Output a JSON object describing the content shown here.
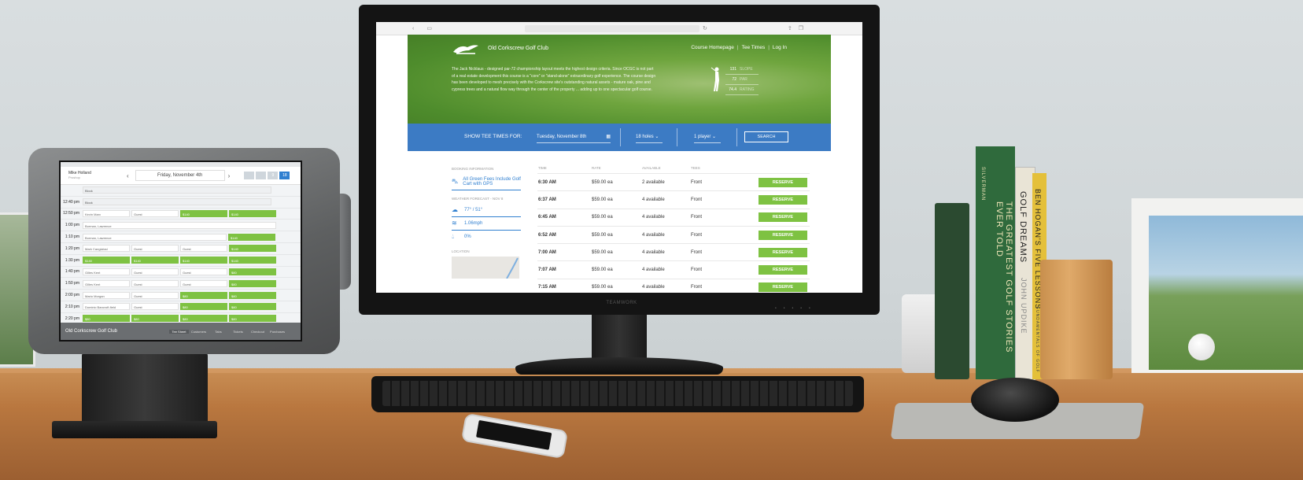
{
  "colors": {
    "hero_green": "#5a9636",
    "search_bar_blue": "#3c7bc4",
    "reserve_green": "#7ec242",
    "link_blue": "#2f7fd0"
  },
  "tablet": {
    "user_name": "Mike Holland",
    "user_role": "Proshop",
    "date": "Friday, November 4th",
    "seg": [
      "",
      "",
      "9",
      "18"
    ],
    "rows": [
      {
        "time": "",
        "slots": [
          {
            "t": "Block",
            "k": "n",
            "w": 240
          }
        ]
      },
      {
        "time": "12:40 pm",
        "slots": [
          {
            "t": "Block",
            "k": "n",
            "w": 240
          }
        ]
      },
      {
        "time": "12:50 pm",
        "slots": [
          {
            "t": "Kevin Marx",
            "k": "w",
            "w": 60
          },
          {
            "t": "Guest",
            "k": "w",
            "w": 60
          },
          {
            "t": "$140",
            "k": "g",
            "w": 60
          },
          {
            "t": "$140",
            "k": "g",
            "w": 60
          }
        ]
      },
      {
        "time": "1:00 pm",
        "slots": [
          {
            "t": "Borman, Lawrence",
            "k": "w",
            "w": 246
          }
        ]
      },
      {
        "time": "1:10 pm",
        "slots": [
          {
            "t": "Borman, Lawrence",
            "k": "w",
            "w": 183
          },
          {
            "t": "$140",
            "k": "g",
            "w": 60
          }
        ]
      },
      {
        "time": "1:20 pm",
        "slots": [
          {
            "t": "Mark Cangialosi",
            "k": "w",
            "w": 60
          },
          {
            "t": "Guest",
            "k": "w",
            "w": 60
          },
          {
            "t": "Guest",
            "k": "w",
            "w": 60
          },
          {
            "t": "$140",
            "k": "g",
            "w": 60
          }
        ]
      },
      {
        "time": "1:30 pm",
        "slots": [
          {
            "t": "$140",
            "k": "g",
            "w": 60
          },
          {
            "t": "$140",
            "k": "g",
            "w": 60
          },
          {
            "t": "$140",
            "k": "g",
            "w": 60
          },
          {
            "t": "$140",
            "k": "g",
            "w": 60
          }
        ]
      },
      {
        "time": "1:40 pm",
        "slots": [
          {
            "t": "Gilles Kent",
            "k": "w",
            "w": 60
          },
          {
            "t": "Guest",
            "k": "w",
            "w": 60
          },
          {
            "t": "Guest",
            "k": "w",
            "w": 60
          },
          {
            "t": "$80",
            "k": "g",
            "w": 60
          }
        ]
      },
      {
        "time": "1:50 pm",
        "slots": [
          {
            "t": "Gilles Kent",
            "k": "w",
            "w": 60
          },
          {
            "t": "Guest",
            "k": "w",
            "w": 60
          },
          {
            "t": "Guest",
            "k": "w",
            "w": 60
          },
          {
            "t": "$80",
            "k": "g",
            "w": 60
          }
        ]
      },
      {
        "time": "2:00 pm",
        "slots": [
          {
            "t": "Mario Morgan",
            "k": "w",
            "w": 60
          },
          {
            "t": "Guest",
            "k": "w",
            "w": 60
          },
          {
            "t": "$80",
            "k": "g",
            "w": 60
          },
          {
            "t": "$80",
            "k": "g",
            "w": 60
          }
        ]
      },
      {
        "time": "2:10 pm",
        "slots": [
          {
            "t": "Dominic Bancroft-field",
            "k": "w",
            "w": 60
          },
          {
            "t": "Guest",
            "k": "w",
            "w": 60
          },
          {
            "t": "$80",
            "k": "g",
            "w": 60
          },
          {
            "t": "$80",
            "k": "g",
            "w": 60
          }
        ]
      },
      {
        "time": "2:20 pm",
        "slots": [
          {
            "t": "$80",
            "k": "g",
            "w": 60
          },
          {
            "t": "$80",
            "k": "g",
            "w": 60
          },
          {
            "t": "$80",
            "k": "g",
            "w": 60
          },
          {
            "t": "$80",
            "k": "g",
            "w": 60
          }
        ]
      }
    ],
    "club": "Old Corkscrew Golf Club",
    "tabs": [
      "Tee Sheet",
      "Customers",
      "Tabs",
      "Tickets",
      "Checkout",
      "Purchases"
    ]
  },
  "monitor": {
    "brand": "TEAMWORK",
    "club_name": "Old Corkscrew Golf Club",
    "nav": [
      "Course Homepage",
      "|",
      "Tee Times",
      "|",
      "Log In"
    ],
    "description": "The Jack Nicklaus - designed par-72 championship layout meets the highest design criteria. Since OCGC is not part of a real estate development this course is a \"core\" or \"stand-alone\" extraordinary golf experience. The course design has been developed to mesh precisely with the Corkscrew site's outstanding natural assets - mature oak, pine and cypress trees and a natural flow way through the center of the property ... adding up to one spectacular golf course.",
    "stats": [
      {
        "value": "131",
        "label": "SLOPE"
      },
      {
        "value": "72",
        "label": "PAR"
      },
      {
        "value": "74.4",
        "label": "RATING"
      }
    ],
    "search": {
      "label": "SHOW TEE TIMES FOR:",
      "date": "Tuesday, November 8th",
      "holes": "18 holes",
      "players": "1 player",
      "button": "SEARCH"
    },
    "side": {
      "booking_header": "BOOKING INFORMATION",
      "booking_text": "All Green Fees Include Golf Cart with GPS",
      "weather_header": "WEATHER FORECAST - NOV 8",
      "temp": "77° / 51°",
      "wind": "1.06mph",
      "rain": "0%",
      "location_header": "LOCATION"
    },
    "table": {
      "headers": [
        "TIME",
        "RATE",
        "AVAILABLE",
        "TEES",
        ""
      ],
      "rows": [
        {
          "time": "6:30 AM",
          "rate": "$59.00 ea",
          "available": "2 available",
          "tees": "Front",
          "action": "RESERVE"
        },
        {
          "time": "6:37 AM",
          "rate": "$59.00 ea",
          "available": "4 available",
          "tees": "Front",
          "action": "RESERVE"
        },
        {
          "time": "6:45 AM",
          "rate": "$59.00 ea",
          "available": "4 available",
          "tees": "Front",
          "action": "RESERVE"
        },
        {
          "time": "6:52 AM",
          "rate": "$59.00 ea",
          "available": "4 available",
          "tees": "Front",
          "action": "RESERVE"
        },
        {
          "time": "7:00 AM",
          "rate": "$59.00 ea",
          "available": "4 available",
          "tees": "Front",
          "action": "RESERVE"
        },
        {
          "time": "7:07 AM",
          "rate": "$59.00 ea",
          "available": "4 available",
          "tees": "Front",
          "action": "RESERVE"
        },
        {
          "time": "7:15 AM",
          "rate": "$59.00 ea",
          "available": "4 available",
          "tees": "Front",
          "action": "RESERVE"
        }
      ]
    }
  },
  "books": [
    {
      "title": "SILVERMAN",
      "color": "#2f5c3a"
    },
    {
      "title": "THE GREATEST GOLF STORIES EVER TOLD",
      "color": "#2f6a3c"
    },
    {
      "title": "GOLF DREAMS",
      "color": "#e9e4d6"
    },
    {
      "title": "JOHN UPDIKE",
      "color": "#e9e4d6"
    },
    {
      "title": "BEN HOGAN'S FIVE LESSONS",
      "color": "#e4c03a"
    },
    {
      "title": "THE MODERN FUNDAMENTALS OF GOLF",
      "color": "#e4c03a"
    }
  ]
}
